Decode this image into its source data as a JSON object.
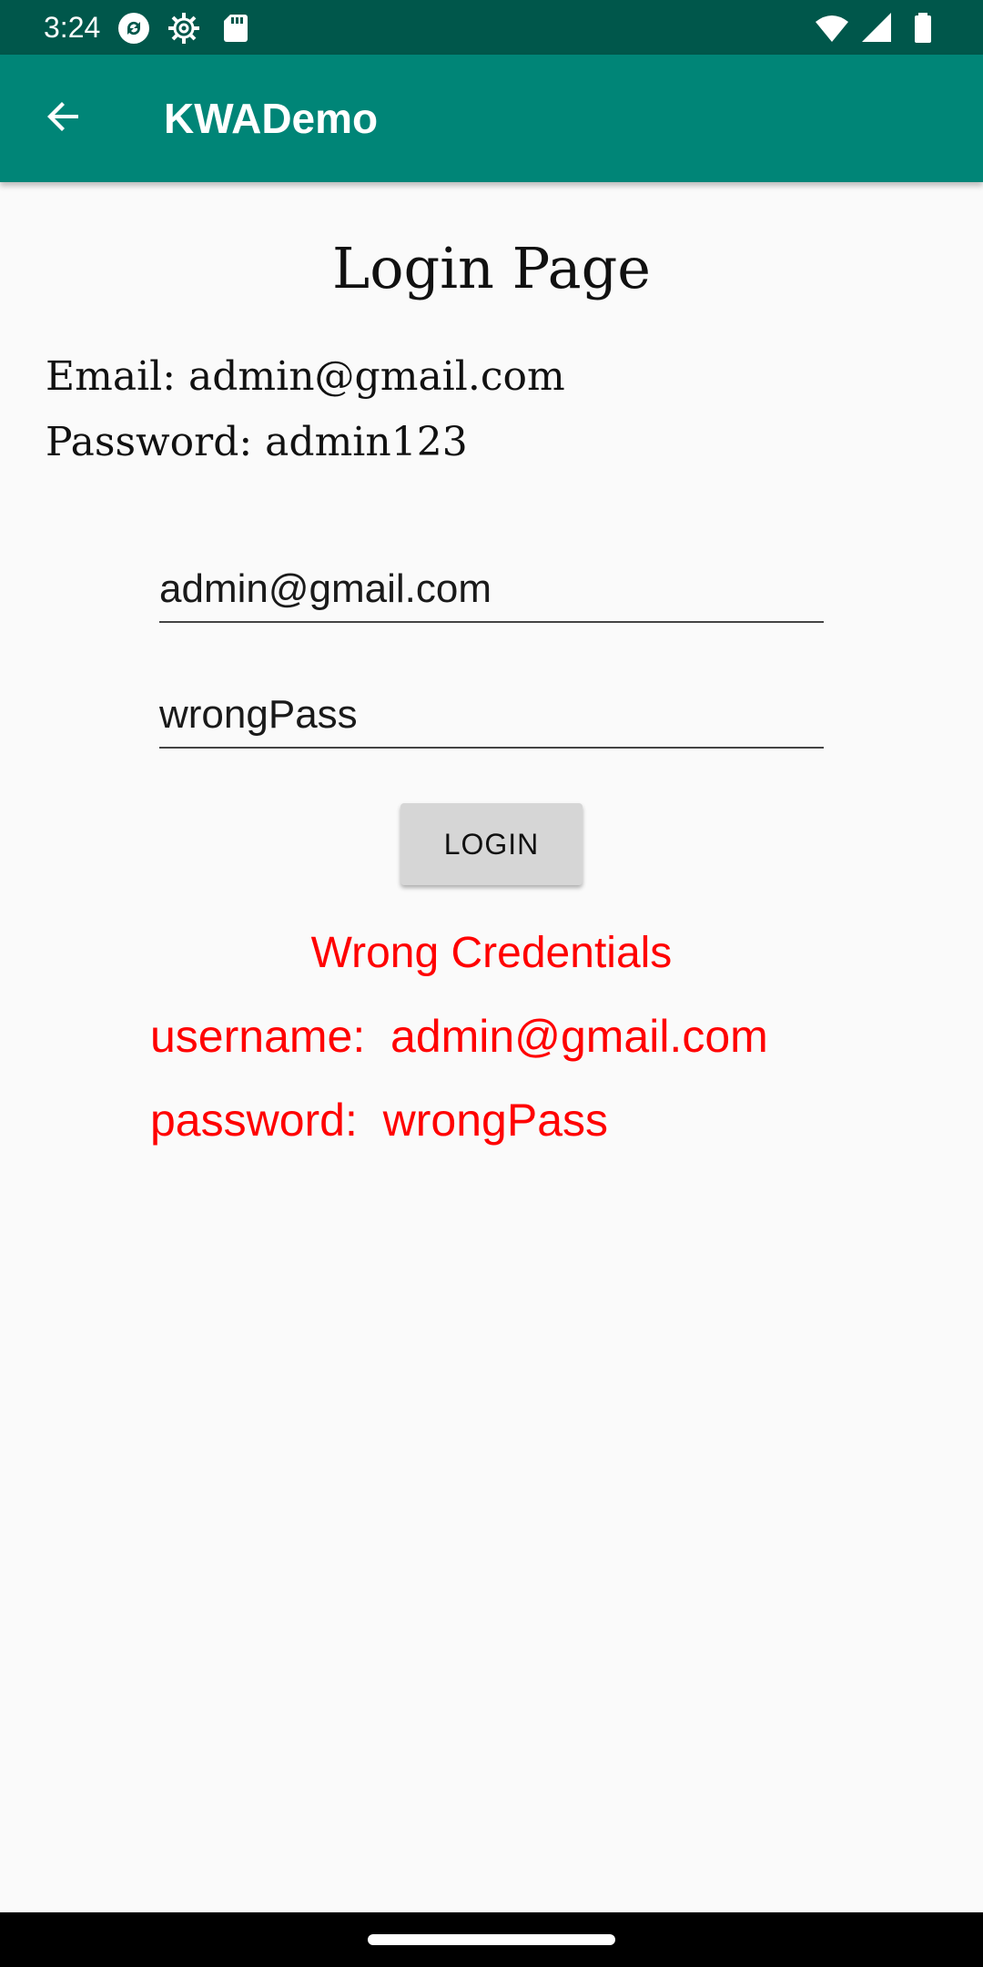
{
  "status_bar": {
    "time": "3:24",
    "icons": [
      "sync-icon",
      "settings-gear-icon",
      "sd-card-icon",
      "wifi-icon",
      "cell-signal-icon",
      "battery-icon"
    ]
  },
  "app_bar": {
    "title": "KWADemo",
    "back_icon": "arrow-back-icon"
  },
  "page": {
    "title": "Login Page",
    "hint_email": "Email: admin@gmail.com",
    "hint_password": "Password: admin123"
  },
  "form": {
    "email_value": "admin@gmail.com",
    "password_value": "wrongPass",
    "login_label": "LOGIN"
  },
  "result": {
    "title": "Wrong Credentials",
    "username_line": "username:  admin@gmail.com",
    "password_line": "password:  wrongPass"
  },
  "colors": {
    "app_bar": "#008577",
    "status_bar": "#00574B",
    "error": "#FF0000",
    "button": "#D6D6D6"
  }
}
